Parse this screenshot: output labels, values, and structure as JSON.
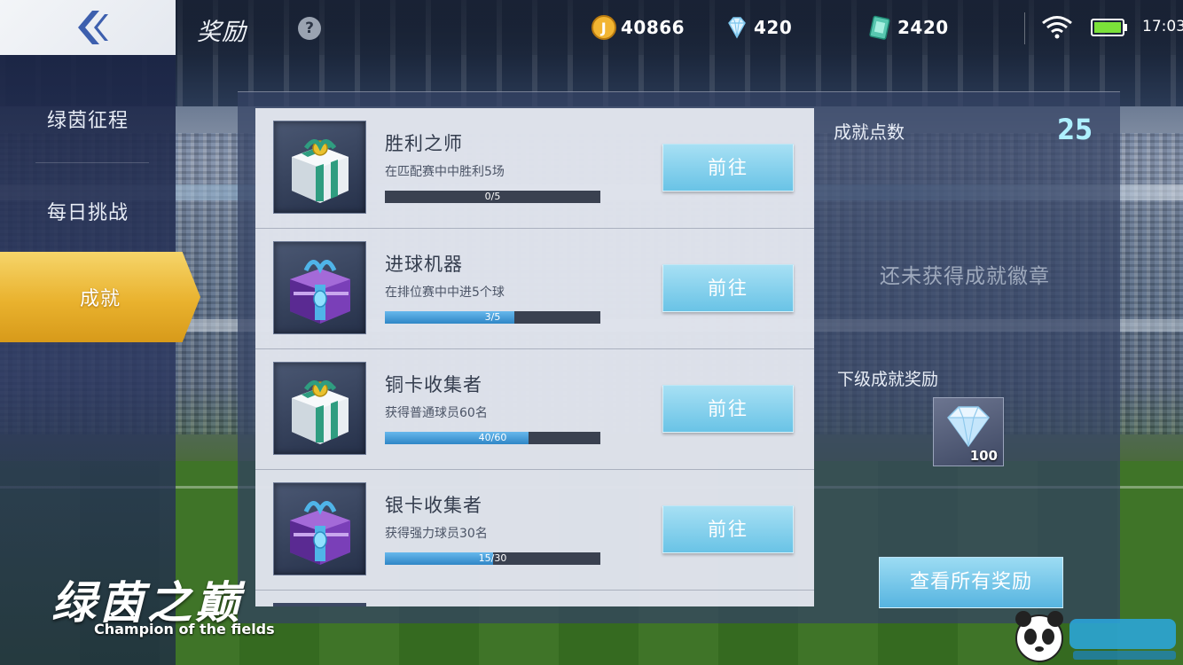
{
  "header": {
    "title": "奖励",
    "help_label": "?",
    "coins": "40866",
    "gems": "420",
    "tickets": "2420",
    "time": "17:03",
    "battery_level": 1.0
  },
  "sidebar": {
    "items": [
      {
        "label": "绿茵征程"
      },
      {
        "label": "每日挑战"
      },
      {
        "label": "成就"
      }
    ],
    "active_index": 2
  },
  "achievements": [
    {
      "title": "胜利之师",
      "desc": "在匹配赛中中胜利5场",
      "progress_text": "0/5",
      "current": 0,
      "total": 5,
      "icon": "green-gift-box-icon",
      "button": "前往"
    },
    {
      "title": "进球机器",
      "desc": "在排位赛中中进5个球",
      "progress_text": "3/5",
      "current": 3,
      "total": 5,
      "icon": "purple-chest-icon",
      "button": "前往"
    },
    {
      "title": "铜卡收集者",
      "desc": "获得普通球员60名",
      "progress_text": "40/60",
      "current": 40,
      "total": 60,
      "icon": "green-gift-box-icon",
      "button": "前往"
    },
    {
      "title": "银卡收集者",
      "desc": "获得强力球员30名",
      "progress_text": "15/30",
      "current": 15,
      "total": 30,
      "icon": "purple-chest-icon",
      "button": "前往"
    }
  ],
  "summary": {
    "points_label": "成就点数",
    "points_value": "25",
    "no_badge_text": "还未获得成就徽章",
    "next_reward_label": "下级成就奖励",
    "next_reward_count": "100",
    "next_reward_icon": "diamond-icon",
    "view_all_label": "查看所有奖励"
  },
  "branding": {
    "logo_cn": "绿茵之巅",
    "logo_en": "Champion of the fields"
  },
  "colors": {
    "accent_gold": "#e9b22e",
    "button_blue": "#69c3e6",
    "progress_blue": "#2f86c6",
    "points_cyan": "#aef0ff"
  }
}
